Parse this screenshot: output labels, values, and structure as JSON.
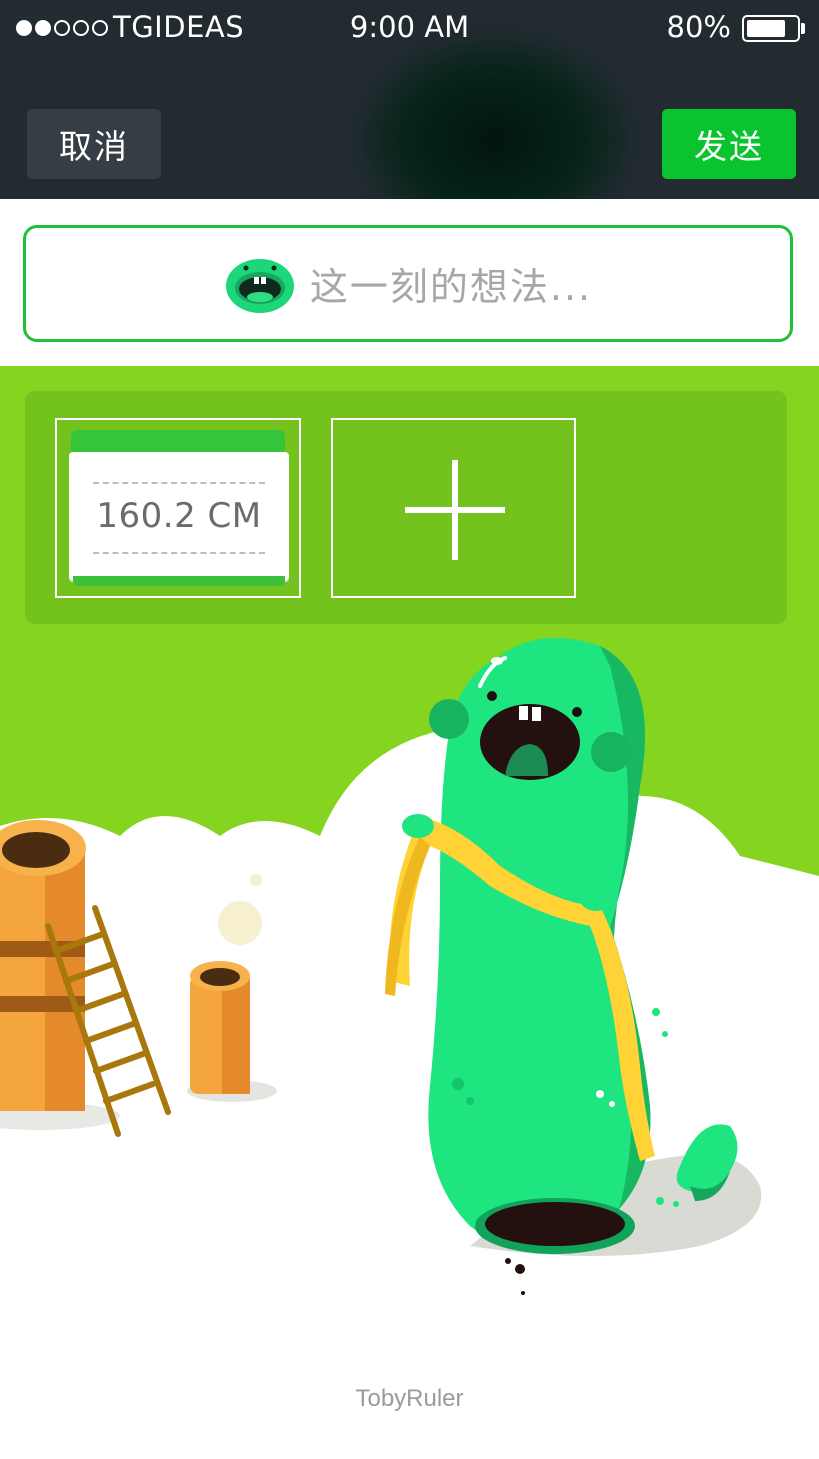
{
  "status_bar": {
    "carrier": "TGIDEAS",
    "time": "9:00 AM",
    "battery_percent": "80%",
    "battery_level": 0.8,
    "signal_strength": 2,
    "signal_max": 5
  },
  "header": {
    "cancel_label": "取消",
    "send_label": "发送"
  },
  "compose": {
    "placeholder": "这一刻的想法..."
  },
  "attachments": {
    "measurement_value": "160.2 CM",
    "add_icon": "plus-icon"
  },
  "footer": {
    "credit": "TobyRuler"
  },
  "colors": {
    "header_bg": "#212b30",
    "send_green": "#09c42e",
    "input_border": "#1fc13a",
    "panel_green": "#84d420",
    "monster_green": "#1ee57f"
  }
}
